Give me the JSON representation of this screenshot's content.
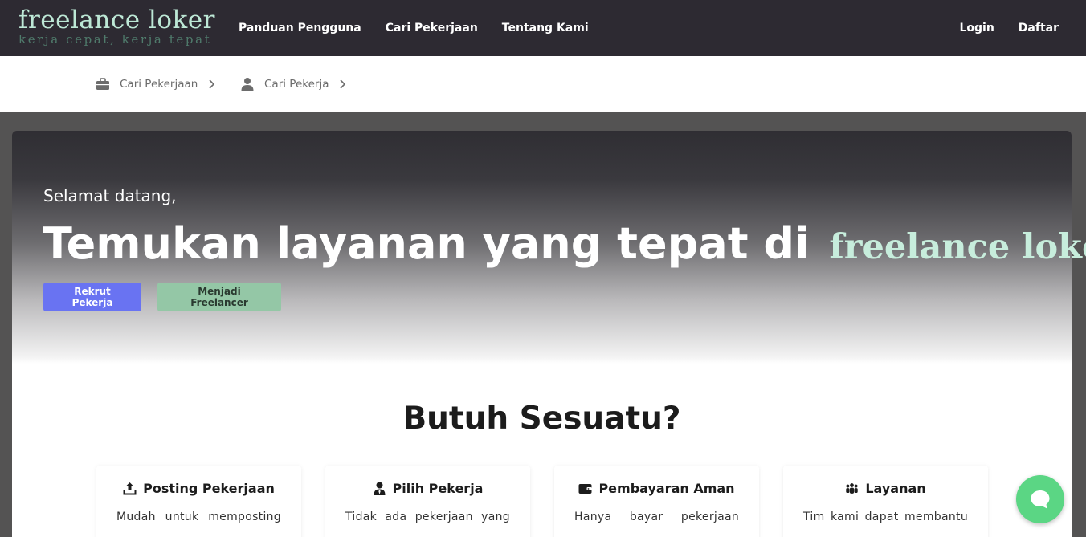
{
  "brand": {
    "name": "freelance loker",
    "tagline": "kerja cepat, kerja tepat"
  },
  "nav": {
    "left": [
      "Panduan Pengguna",
      "Cari Pekerjaan",
      "Tentang Kami"
    ],
    "right": [
      "Login",
      "Daftar"
    ]
  },
  "subnav": [
    {
      "label": "Cari Pekerjaan",
      "icon": "briefcase-icon"
    },
    {
      "label": "Cari Pekerja",
      "icon": "user-icon"
    }
  ],
  "hero": {
    "greeting": "Selamat datang,",
    "headline": "Temukan layanan yang tepat di",
    "headline_brand": "freelance loker",
    "primary_button": "Rekrut Pekerja",
    "secondary_button": "Menjadi Freelancer"
  },
  "section": {
    "title": "Butuh Sesuatu?",
    "features": [
      {
        "title": "Posting Pekerjaan",
        "icon": "upload-icon",
        "desc": "Mudah untuk memposting"
      },
      {
        "title": "Pilih Pekerja",
        "icon": "user-tie-icon",
        "desc": "Tidak ada pekerjaan yang"
      },
      {
        "title": "Pembayaran Aman",
        "icon": "wallet-icon",
        "desc": "Hanya bayar pekerjaan"
      },
      {
        "title": "Layanan",
        "icon": "users-icon",
        "desc": "Tim kami dapat membantu"
      }
    ]
  },
  "colors": {
    "topbar": "#2d2a32",
    "brand_accent": "#bde8d6",
    "primary": "#6973f2",
    "secondary": "#94c7a6",
    "chat": "#5bd684"
  }
}
